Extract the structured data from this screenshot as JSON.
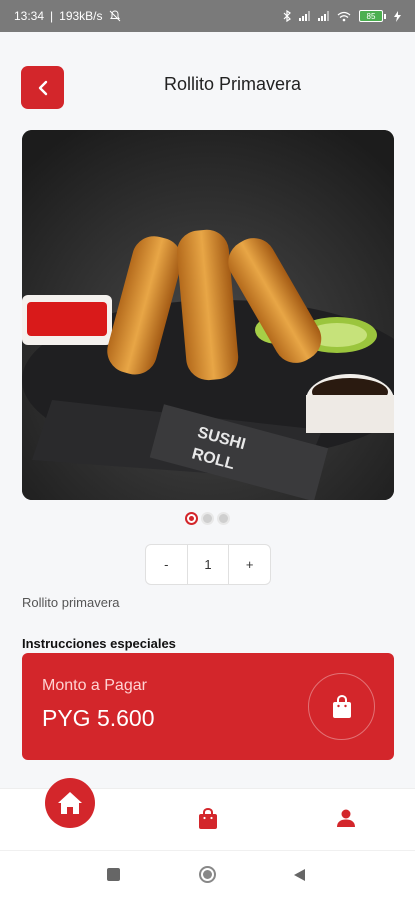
{
  "status": {
    "time": "13:34",
    "network": "193kB/s",
    "battery": "85"
  },
  "header": {
    "title": "Rollito Primavera"
  },
  "product": {
    "carousel": {
      "count": 3,
      "active": 1
    },
    "quantity": {
      "minus_label": "-",
      "value": "1",
      "plus_label": "+"
    },
    "description": "Rollito primavera",
    "special_instructions_label": "Instrucciones especiales"
  },
  "payment": {
    "label": "Monto a Pagar",
    "amount": "PYG 5.600"
  },
  "photo": {
    "brand_text_line1": "SUSHI",
    "brand_text_line2": "ROLL"
  },
  "nav": {
    "items": [
      "home-icon",
      "bag-icon",
      "user-icon"
    ]
  },
  "colors": {
    "accent": "#d3262b",
    "background": "#f6f7f9"
  }
}
